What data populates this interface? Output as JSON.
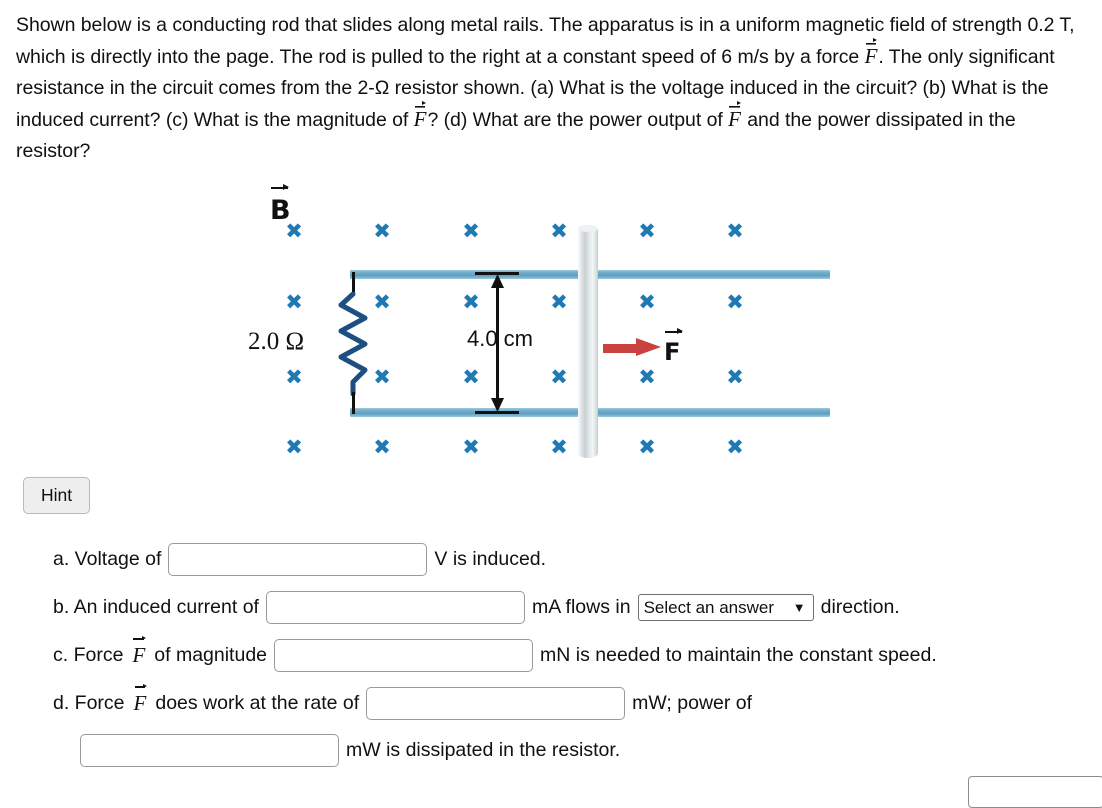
{
  "problem": {
    "text_part_1": "Shown below is a conducting rod that slides along metal rails. The apparatus is in a uniform magnetic field of strength 0.2 T, which is directly into the page. The rod is pulled to the right at a constant speed of 6 m/s by a force ",
    "force_symbol": "F",
    "text_part_2": ". The only significant resistance in the circuit comes from the 2-Ω resistor shown. (a) What is the voltage induced in the circuit? (b) What is the induced current? (c) What is the magnitude of ",
    "text_part_3": "? (d) What are the power output of ",
    "text_part_4": " and the power dissipated in the resistor?"
  },
  "figure": {
    "field_label": "B",
    "field_symbol_count": 24,
    "resistance_label": "2.0 Ω",
    "length_label": "4.0 cm",
    "force_label": "F",
    "field_x_color": "#1f7ab4",
    "rail_color": "#5d9fc0",
    "resistor_color": "#1d4f81",
    "force_arrow_color": "#c9423f",
    "rod_color": "#d7dde0"
  },
  "hint": {
    "label": "Hint"
  },
  "answers": {
    "a": {
      "prefix": "a. Voltage of",
      "value": "",
      "suffix": "V is induced."
    },
    "b": {
      "prefix": "b. An induced current of",
      "value": "",
      "unit": "mA flows in",
      "select_value": "Select an answer",
      "select_options": [
        "Select an answer"
      ],
      "suffix": "direction."
    },
    "c": {
      "prefix_1": "c. Force",
      "force_symbol": "F",
      "prefix_2": "of magnitude",
      "value": "",
      "suffix": "mN is needed to maintain the constant speed."
    },
    "d": {
      "prefix_1": "d. Force",
      "force_symbol": "F",
      "prefix_2": "does work at the rate of",
      "value": "",
      "suffix": "mW; power of",
      "value2": "",
      "suffix2": "mW is dissipated in the resistor."
    }
  }
}
